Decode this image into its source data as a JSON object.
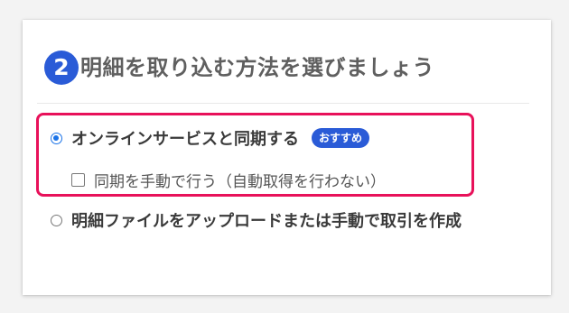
{
  "section": {
    "step_number": "2",
    "title": "明細を取り込む方法を選びましょう"
  },
  "options": [
    {
      "label": "オンラインサービスと同期する",
      "badge": "おすすめ",
      "selected": true
    },
    {
      "label": "同期を手動で行う（自動取得を行わない）",
      "checked": false
    },
    {
      "label": "明細ファイルをアップロードまたは手動で取引を作成",
      "selected": false
    }
  ],
  "colors": {
    "accent_blue": "#2a5bd7",
    "radio_blue": "#1a73e8",
    "highlight_pink": "#e8115a",
    "heading_gray": "#5f5f5f"
  }
}
